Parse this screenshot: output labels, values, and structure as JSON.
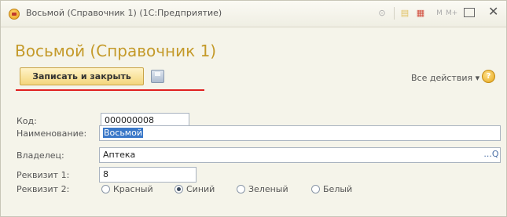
{
  "window": {
    "title": "Восьмой (Справочник 1) (1С:Предприятие)",
    "icon": "1c-app-icon"
  },
  "form": {
    "title": "Восьмой (Справочник 1)"
  },
  "toolbar": {
    "save_close_label": "Записать и закрыть",
    "all_actions_label": "Все действия ▾",
    "help_label": "?",
    "highlight_color": "#e02020"
  },
  "fields": {
    "code": {
      "label": "Код:",
      "value": "000000008"
    },
    "name": {
      "label": "Наименование:",
      "value": "Восьмой"
    },
    "owner": {
      "label": "Владелец:",
      "value": "Аптека",
      "button": "...Q"
    },
    "attr1": {
      "label": "Реквизит 1:",
      "value": "8"
    },
    "attr2": {
      "label": "Реквизит 2:",
      "options": [
        "Красный",
        "Синий",
        "Зеленый",
        "Белый"
      ],
      "selected": "Синий"
    }
  },
  "colors": {
    "title_accent": "#c49a2a",
    "button_bg": "#f4d67c"
  }
}
